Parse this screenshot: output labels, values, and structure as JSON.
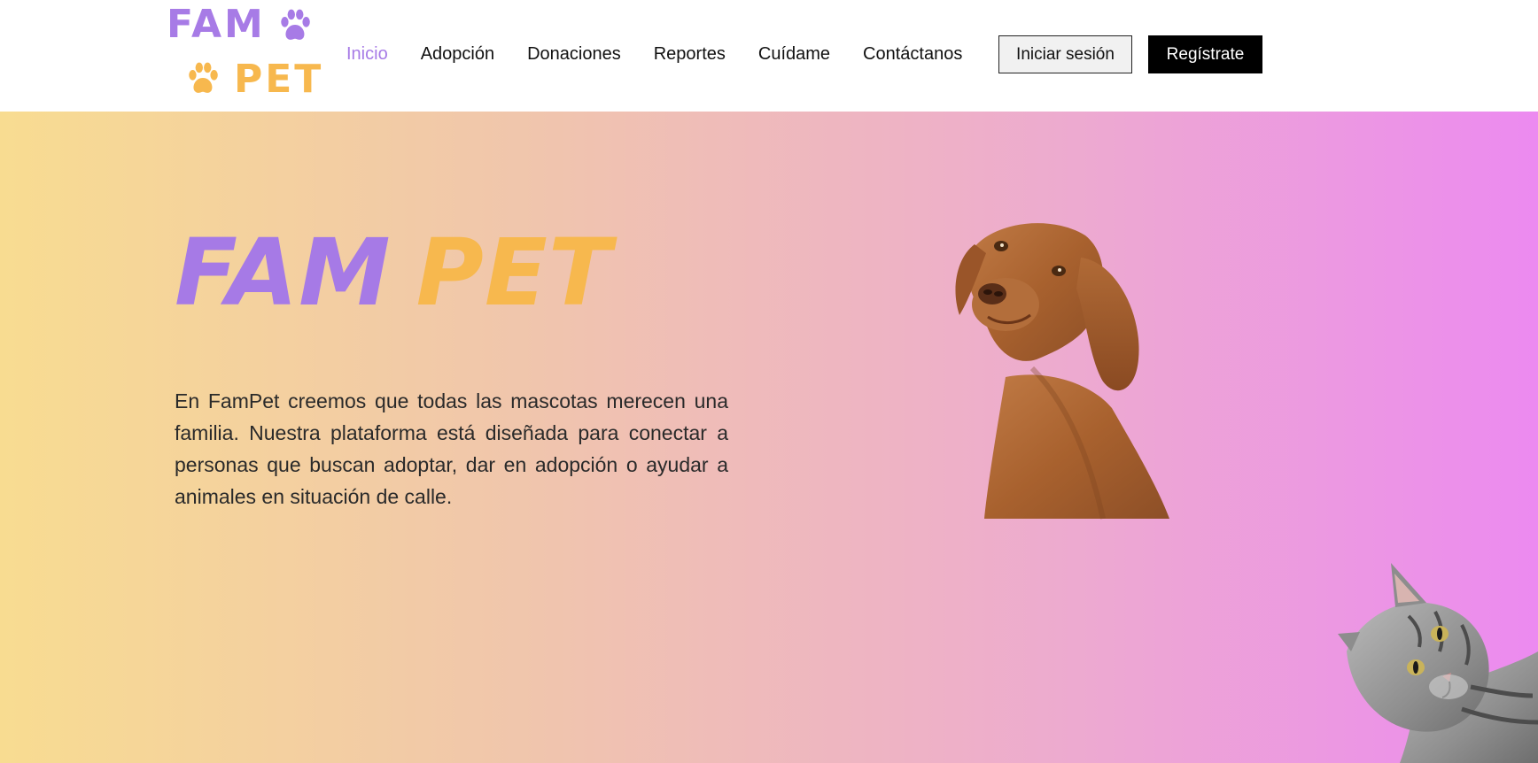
{
  "header": {
    "logo": {
      "word1": "FAM",
      "word2": "PET",
      "icon": "paw-icon"
    },
    "nav": [
      {
        "label": "Inicio",
        "active": true
      },
      {
        "label": "Adopción",
        "active": false
      },
      {
        "label": "Donaciones",
        "active": false
      },
      {
        "label": "Reportes",
        "active": false
      },
      {
        "label": "Cuídame",
        "active": false
      },
      {
        "label": "Contáctanos",
        "active": false
      }
    ],
    "login_label": "Iniciar sesión",
    "register_label": "Regístrate"
  },
  "hero": {
    "title_part1": "FAM",
    "title_part2": "PET",
    "description": "En FamPet creemos que todas las mascotas merecen una familia. Nuestra plataforma está diseñada para conectar a personas que buscan adoptar, dar en adopción o ayudar a animales en situación de calle.",
    "images": [
      "dog-photo",
      "cat-photo"
    ]
  },
  "colors": {
    "brand_purple": "#a77be6",
    "brand_orange": "#f7b84e",
    "gradient_start": "#f8dc91",
    "gradient_end": "#ec8af0"
  }
}
